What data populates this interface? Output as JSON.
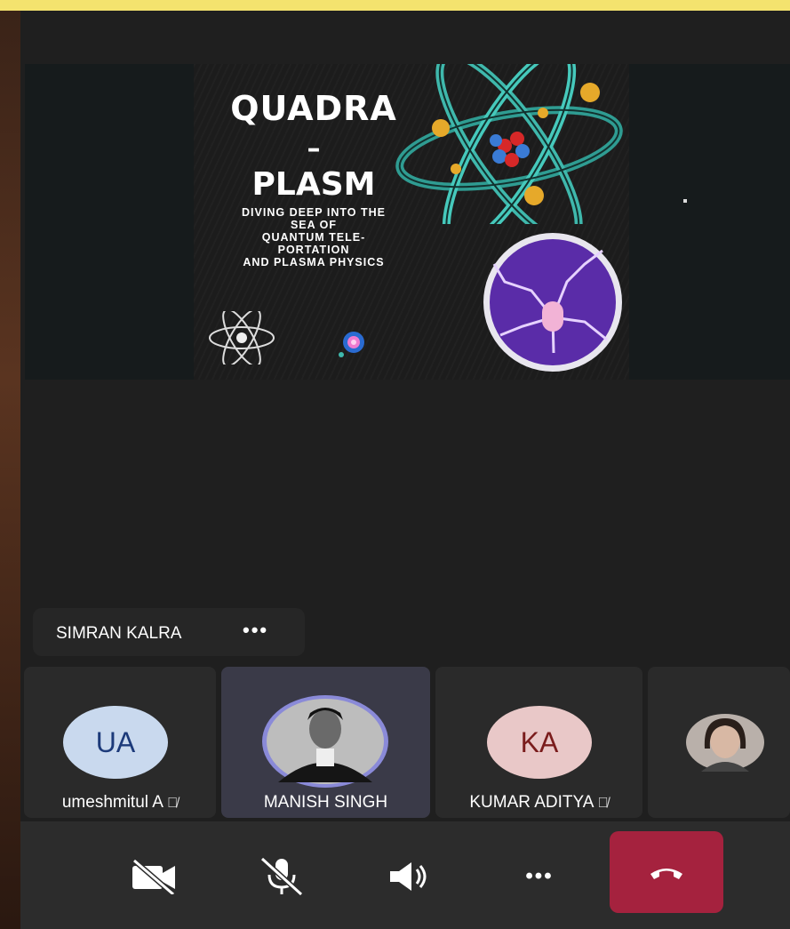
{
  "slide": {
    "title_line1": "QUADRA",
    "title_line2": "–",
    "title_line3": "PLASM",
    "subtitle_lines": [
      "DIVING DEEP INTO THE",
      "SEA OF",
      "QUANTUM TELE-",
      "PORTATION",
      "AND PLASMA PHYSICS"
    ]
  },
  "pinned": {
    "name": "SIMRAN KALRA",
    "more": "•••"
  },
  "participants": [
    {
      "initials": "UA",
      "name": "umeshmitul A",
      "muted": true,
      "avatar_bg": "#c9d9ee",
      "initials_color": "#1c3a7a"
    },
    {
      "initials": "",
      "name": "MANISH SINGH",
      "muted": false,
      "photo": "portrait",
      "active": true
    },
    {
      "initials": "KA",
      "name": "KUMAR ADITYA",
      "muted": true,
      "avatar_bg": "#e9c8c8",
      "initials_color": "#7a1c1c"
    },
    {
      "initials": "",
      "name": "",
      "photo": "portrait"
    }
  ],
  "controls": {
    "camera": "camera-off-icon",
    "mic": "mic-off-icon",
    "speaker": "speaker-icon",
    "more": "•••",
    "end_call": "end-call-icon"
  },
  "colors": {
    "end_call": "#a5223e",
    "active_tile": "#3a3a48",
    "accent_ring": "#8a8ad8"
  }
}
